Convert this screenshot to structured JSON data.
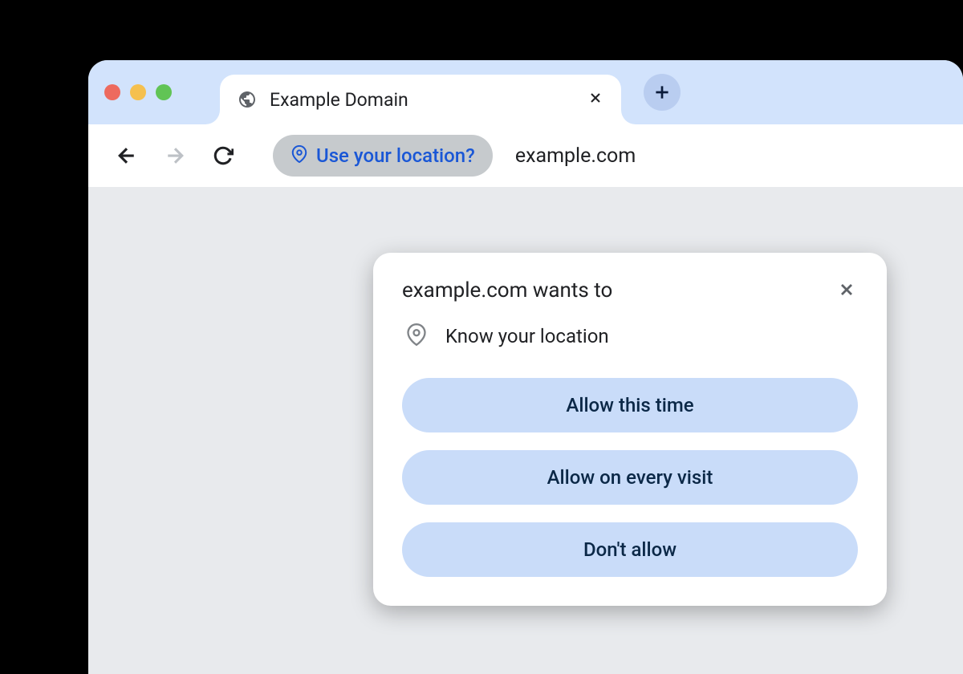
{
  "tab": {
    "title": "Example Domain"
  },
  "toolbar": {
    "permission_chip": "Use your location?",
    "url": "example.com"
  },
  "dialog": {
    "title": "example.com wants to",
    "permission": "Know your location",
    "buttons": {
      "allow_once": "Allow this time",
      "allow_always": "Allow on every visit",
      "deny": "Don't allow"
    }
  }
}
